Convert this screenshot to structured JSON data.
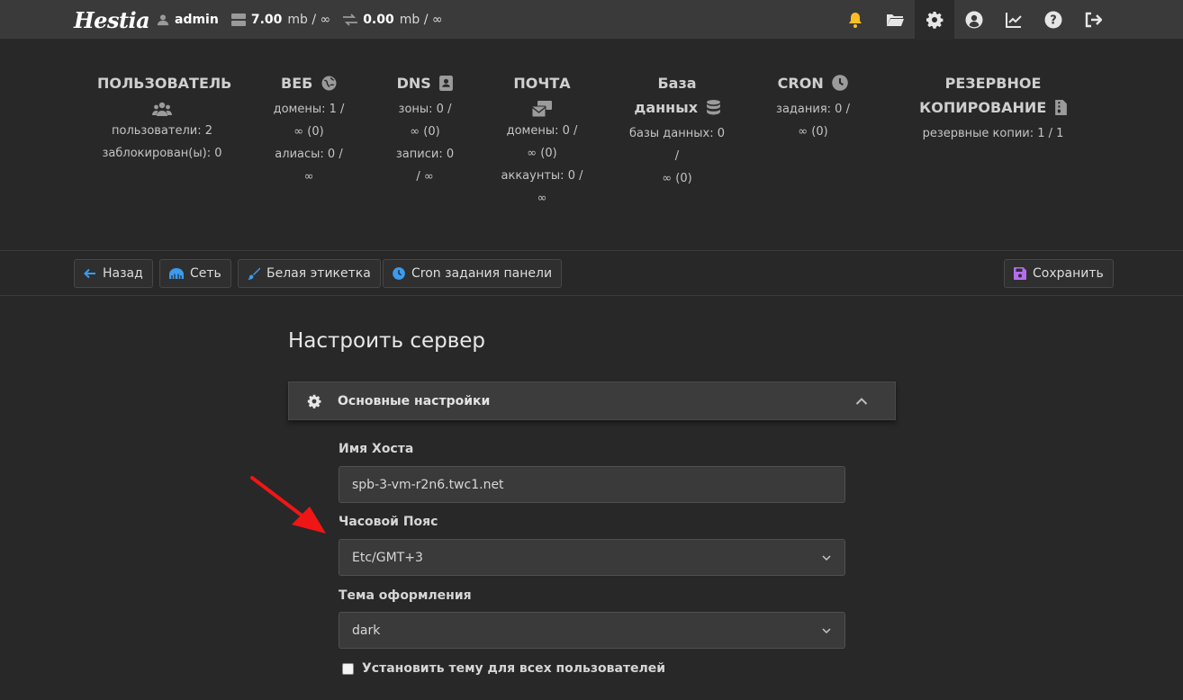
{
  "topbar": {
    "logo": "Hestia",
    "user": "admin",
    "disk_used": "7.00",
    "disk_unit": "mb / ∞",
    "bandwidth_used": "0.00",
    "bandwidth_unit": "mb / ∞",
    "icons": [
      "bell-icon",
      "folder-icon",
      "gear-icon",
      "user-circle-icon",
      "chart-line-icon",
      "help-icon",
      "logout-icon"
    ],
    "bell_color": "#fbbf24"
  },
  "summary": {
    "users": {
      "title": "ПОЛЬЗОВАТЕЛЬ",
      "line1": "пользователи: 2",
      "line2": "заблокирован(ы): 0"
    },
    "web": {
      "title": "ВЕБ",
      "domains_a": "домены: 1 /",
      "domains_b": "∞ (0)",
      "aliases_a": "алиасы: 0 /",
      "aliases_b": "∞"
    },
    "dns": {
      "title": "DNS",
      "zones_a": "зоны: 0 /",
      "zones_b": "∞ (0)",
      "records_a": "записи: 0",
      "records_b": "/ ∞"
    },
    "mail": {
      "title": "ПОЧТА",
      "domains_a": "домены: 0 /",
      "domains_b": "∞ (0)",
      "accounts_a": "аккаунты: 0 /",
      "accounts_b": "∞"
    },
    "db": {
      "title_a": "База",
      "title_b": "данных",
      "line_a": "базы данных: 0 /",
      "line_b": "∞ (0)"
    },
    "cron": {
      "title": "CRON",
      "line_a": "задания: 0 /",
      "line_b": "∞ (0)"
    },
    "backup": {
      "title_a": "РЕЗЕРВНОЕ",
      "title_b": "КОПИРОВАНИЕ",
      "line": "резервные копии: 1 / 1"
    }
  },
  "toolbar": {
    "back": "Назад",
    "network": "Сеть",
    "white_label": "Белая этикетка",
    "cron": "Cron задания панели",
    "save": "Сохранить"
  },
  "main": {
    "title": "Настроить сервер",
    "section": "Основные настройки",
    "hostname_label": "Имя Хоста",
    "hostname_value": "spb-3-vm-r2n6.twc1.net",
    "timezone_label": "Часовой Пояс",
    "timezone_value": "Etc/GMT+3",
    "theme_label": "Тема оформления",
    "theme_value": "dark",
    "apply_theme_label": "Установить тему для всех пользователей"
  },
  "colors": {
    "accent_blue": "#3a9bf0",
    "save_icon": "#b66cf0",
    "annotation_arrow": "#f01616"
  }
}
